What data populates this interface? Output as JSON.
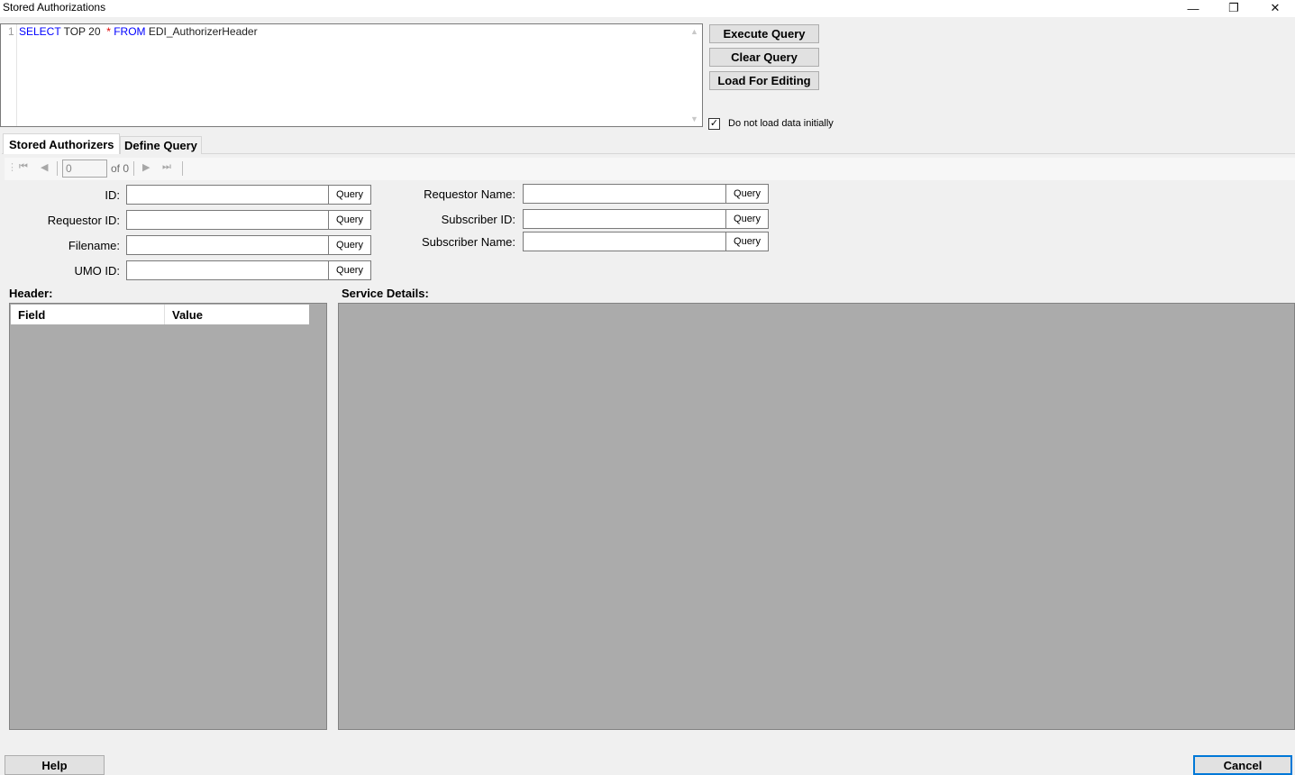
{
  "window": {
    "title": "Stored Authorizations",
    "minimize_glyph": "—",
    "restore_glyph": "❐",
    "close_glyph": "✕"
  },
  "editor": {
    "line_number": "1",
    "tokens": [
      "SELECT",
      "TOP 20",
      "*",
      "FROM",
      "EDI_AuthorizerHeader"
    ]
  },
  "actions": {
    "execute": "Execute Query",
    "clear": "Clear Query",
    "load": "Load For Editing",
    "no_load_label": "Do not load data initially",
    "no_load_checked": true
  },
  "tabs": {
    "stored": "Stored Authorizers",
    "define": "Define Query"
  },
  "navigator": {
    "position": "0",
    "of_label": "of 0"
  },
  "filters": {
    "query_label": "Query",
    "id": "ID:",
    "requestor_id": "Requestor ID:",
    "filename": "Filename:",
    "umo_id": "UMO ID:",
    "requestor_name": "Requestor Name:",
    "subscriber_id": "Subscriber ID:",
    "subscriber_name": "Subscriber Name:"
  },
  "header_panel": {
    "title": "Header:",
    "columns": [
      "Field",
      "Value"
    ]
  },
  "service_panel": {
    "title": "Service Details:"
  },
  "footer": {
    "help": "Help",
    "cancel": "Cancel"
  },
  "colors": {
    "keyword": "#0000ff",
    "operator": "#e00000",
    "grid_background": "#ababab",
    "focus_border": "#0078d7"
  }
}
